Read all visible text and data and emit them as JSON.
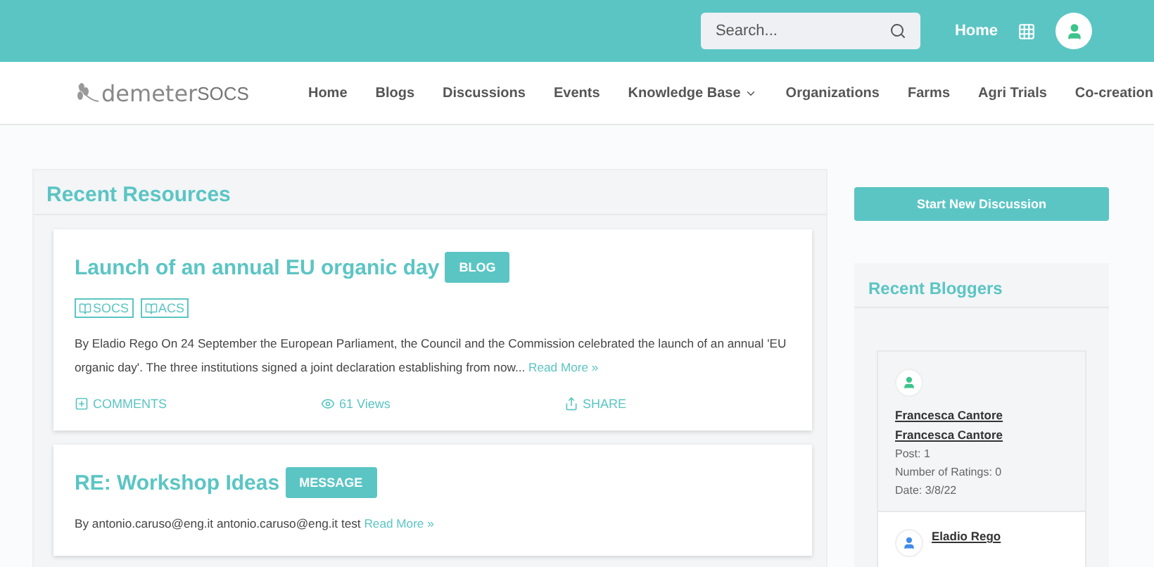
{
  "topbar": {
    "search": {
      "placeholder": "Search..."
    },
    "home_link": "Home"
  },
  "navbar": {
    "logo": "demeter",
    "site": "SOCS",
    "items": [
      {
        "label": "Home",
        "dropdown": false
      },
      {
        "label": "Blogs",
        "dropdown": false
      },
      {
        "label": "Discussions",
        "dropdown": false
      },
      {
        "label": "Events",
        "dropdown": false
      },
      {
        "label": "Knowledge Base",
        "dropdown": true
      },
      {
        "label": "Organizations",
        "dropdown": false
      },
      {
        "label": "Farms",
        "dropdown": false
      },
      {
        "label": "Agri Trials",
        "dropdown": false
      },
      {
        "label": "Co-creation",
        "dropdown": false
      }
    ]
  },
  "resources": {
    "title": "Recent Resources",
    "items": [
      {
        "title": "Launch of an annual EU organic day",
        "badge": "BLOG",
        "tags": [
          "SOCS",
          "ACS"
        ],
        "author": "By Eladio Rego",
        "text": "On 24 September the European Parliament, the Council and the Commission celebrated the launch of an annual 'EU organic day'. The three institutions signed a joint declaration establishing from now...",
        "read_more": "Read More »",
        "actions": {
          "comments": "COMMENTS",
          "views": "61 Views",
          "share": "SHARE"
        }
      },
      {
        "title": "RE: Workshop Ideas",
        "badge": "MESSAGE",
        "author": "By antonio.caruso@eng.it",
        "text": "antonio.caruso@eng.it test",
        "read_more": "Read More »"
      }
    ]
  },
  "sidebar": {
    "button": "Start New Discussion",
    "bloggers_title": "Recent Bloggers",
    "bloggers": [
      {
        "names": [
          "Francesca Cantore",
          "Francesca Cantore"
        ],
        "color": "#3cc48a",
        "stats": [
          "Post: 1",
          "Number of Ratings: 0",
          "Date: 3/8/22"
        ]
      },
      {
        "names": [
          "Eladio Rego"
        ],
        "color": "#3f8cea"
      }
    ]
  }
}
